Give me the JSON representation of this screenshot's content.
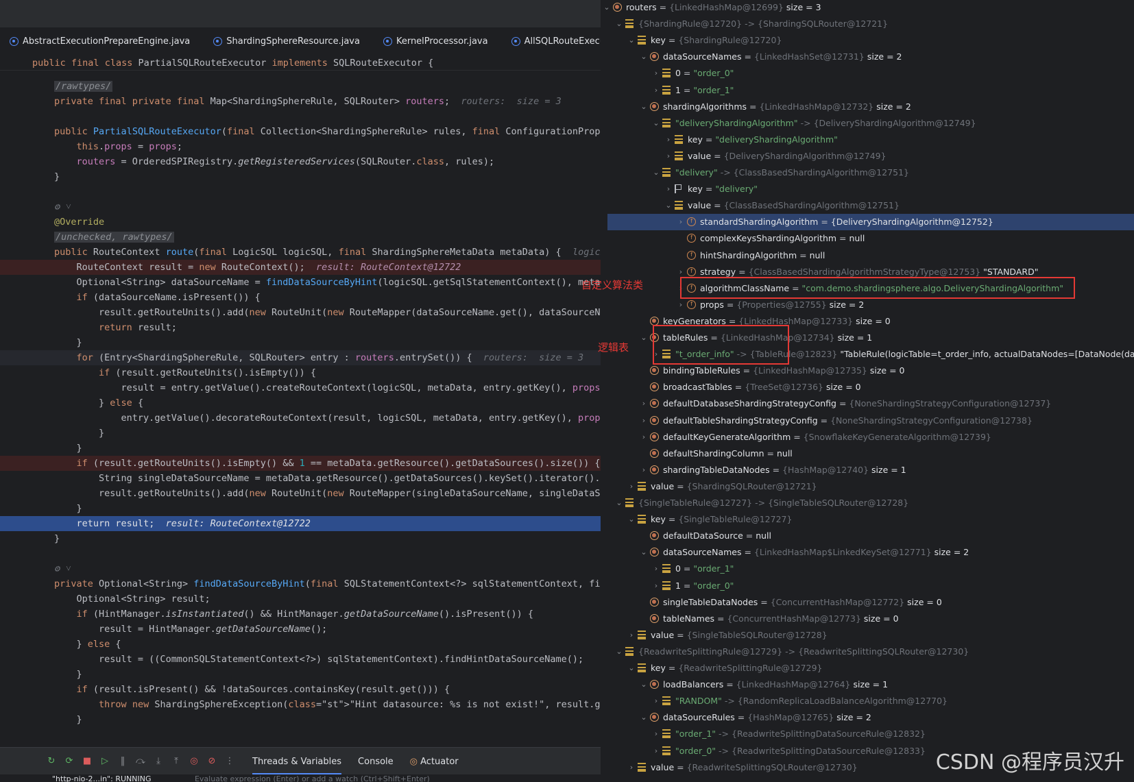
{
  "editor": {
    "tabs": [
      {
        "label": "AbstractExecutionPrepareEngine.java"
      },
      {
        "label": "ShardingSphereResource.java"
      },
      {
        "label": "KernelProcessor.java"
      },
      {
        "label": "AllSQLRouteExecutor.java"
      }
    ],
    "class_header": "public final class PartialSQLRouteExecutor implements SQLRouteExecutor {",
    "lines": {
      "l1_sup": "/rawtypes/",
      "l2": "private final Map<ShardingSphereRule, SQLRouter> routers;",
      "l2_hint": "routers:  size = 3",
      "l4": "public PartialSQLRouteExecutor(final Collection<ShardingSphereRule> rules, final ConfigurationProper",
      "l5": "this.props = props;",
      "l6": "routers = OrderedSPIRegistry.getRegisteredServices(SQLRouter.class, rules);",
      "l7": "}",
      "l9_icon": "⚙ ˅",
      "l10": "@Override",
      "l11_sup": "/unchecked, rawtypes/",
      "l12": "public RouteContext route(final LogicSQL logicSQL, final ShardingSphereMetaData metaData) {",
      "l12_hint": "logicS",
      "l13": "RouteContext result = new RouteContext();",
      "l13_hint": "result: RouteContext@12722",
      "l14": "Optional<String> dataSourceName = findDataSourceByHint(logicSQL.getSqlStatementContext(), metaDa",
      "l15": "if (dataSourceName.isPresent()) {",
      "l16": "result.getRouteUnits().add(new RouteUnit(new RouteMapper(dataSourceName.get(), dataSourceNam",
      "l17": "return result;",
      "l18": "}",
      "l19": "for (Entry<ShardingSphereRule, SQLRouter> entry : routers.entrySet()) {",
      "l19_hint": "routers:  size = 3",
      "l20": "if (result.getRouteUnits().isEmpty()) {",
      "l21": "result = entry.getValue().createRouteContext(logicSQL, metaData, entry.getKey(), props);",
      "l22": "} else {",
      "l23": "entry.getValue().decorateRouteContext(result, logicSQL, metaData, entry.getKey(), props",
      "l24": "}",
      "l25": "}",
      "l26": "if (result.getRouteUnits().isEmpty() && 1 == metaData.getResource().getDataSources().size()) {",
      "l27": "String singleDataSourceName = metaData.getResource().getDataSources().keySet().iterator().ne",
      "l28": "result.getRouteUnits().add(new RouteUnit(new RouteMapper(singleDataSourceName, singleDataSou",
      "l29": "}",
      "l30": "return result;",
      "l30_hint": "result: RouteContext@12722",
      "l31": "}",
      "l33_icon": "⚙ ˅",
      "l34": "private Optional<String> findDataSourceByHint(final SQLStatementContext<?> sqlStatementContext, fina",
      "l35": "Optional<String> result;",
      "l36": "if (HintManager.isInstantiated() && HintManager.getDataSourceName().isPresent()) {",
      "l37": "result = HintManager.getDataSourceName();",
      "l38": "} else {",
      "l39": "result = ((CommonSQLStatementContext<?>) sqlStatementContext).findHintDataSourceName();",
      "l40": "}",
      "l41": "if (result.isPresent() && !dataSources.containsKey(result.get())) {",
      "l42": "throw new ShardingSphereException(\"Hint datasource: %s is not exist!\", result.get());",
      "l43": "}"
    },
    "bottom_tabs": {
      "threads_vars": "Threads & Variables",
      "console": "Console",
      "actuator": "Actuator"
    },
    "thread_row": "\"http-nio-2...in\": RUNNING",
    "eval_placeholder": "Evaluate expression (Enter) or add a watch (Ctrl+Shift+Enter)"
  },
  "tree": [
    {
      "name": "routers",
      "ref": "{LinkedHashMap@12699}",
      "extra": "size = 3"
    },
    {
      "name": "{ShardingRule@12720}",
      "arrow": "->",
      "ref": "{ShardingSQLRouter@12721}"
    },
    {
      "name": "key",
      "ref": "{ShardingRule@12720}"
    },
    {
      "name": "dataSourceNames",
      "ref": "{LinkedHashSet@12731}",
      "extra": "size = 2"
    },
    {
      "name": "0",
      "str": "\"order_0\""
    },
    {
      "name": "1",
      "str": "\"order_1\""
    },
    {
      "name": "shardingAlgorithms",
      "ref": "{LinkedHashMap@12732}",
      "extra": "size = 2"
    },
    {
      "name": "\"deliveryShardingAlgorithm\"",
      "arrow": "->",
      "ref": "{DeliveryShardingAlgorithm@12749}"
    },
    {
      "name": "key",
      "str": "\"deliveryShardingAlgorithm\""
    },
    {
      "name": "value",
      "ref": "{DeliveryShardingAlgorithm@12749}"
    },
    {
      "name": "\"delivery\"",
      "arrow": "->",
      "ref": "{ClassBasedShardingAlgorithm@12751}"
    },
    {
      "name": "key",
      "str": "\"delivery\""
    },
    {
      "name": "value",
      "ref": "{ClassBasedShardingAlgorithm@12751}"
    },
    {
      "name": "standardShardingAlgorithm",
      "valtext": "{DeliveryShardingAlgorithm@12752}"
    },
    {
      "name": "complexKeysShardingAlgorithm",
      "valtext": "null"
    },
    {
      "name": "hintShardingAlgorithm",
      "valtext": "null"
    },
    {
      "name": "strategy",
      "ref": "{ClassBasedShardingAlgorithmStrategyType@12753}",
      "extra": "\"STANDARD\""
    },
    {
      "name": "algorithmClassName",
      "str": "\"com.demo.shardingsphere.algo.DeliveryShardingAlgorithm\""
    },
    {
      "name": "props",
      "ref": "{Properties@12755}",
      "extra": "size = 2"
    },
    {
      "name": "keyGenerators",
      "ref": "{LinkedHashMap@12733}",
      "extra": "size = 0"
    },
    {
      "name": "tableRules",
      "ref": "{LinkedHashMap@12734}",
      "extra": "size = 1"
    },
    {
      "name": "\"t_order_info\"",
      "arrow": "->",
      "ref": "{TableRule@12823}",
      "extra": "\"TableRule(logicTable=t_order_info, actualDataNodes=[DataNode(dataSou"
    },
    {
      "name": "bindingTableRules",
      "ref": "{LinkedHashMap@12735}",
      "extra": "size = 0"
    },
    {
      "name": "broadcastTables",
      "ref": "{TreeSet@12736}",
      "extra": "size = 0"
    },
    {
      "name": "defaultDatabaseShardingStrategyConfig",
      "ref": "{NoneShardingStrategyConfiguration@12737}"
    },
    {
      "name": "defaultTableShardingStrategyConfig",
      "ref": "{NoneShardingStrategyConfiguration@12738}"
    },
    {
      "name": "defaultKeyGenerateAlgorithm",
      "ref": "{SnowflakeKeyGenerateAlgorithm@12739}"
    },
    {
      "name": "defaultShardingColumn",
      "valtext": "null"
    },
    {
      "name": "shardingTableDataNodes",
      "ref": "{HashMap@12740}",
      "extra": "size = 1"
    },
    {
      "name": "value",
      "ref": "{ShardingSQLRouter@12721}"
    },
    {
      "name": "{SingleTableRule@12727}",
      "arrow": "->",
      "ref": "{SingleTableSQLRouter@12728}"
    },
    {
      "name": "key",
      "ref": "{SingleTableRule@12727}"
    },
    {
      "name": "defaultDataSource",
      "valtext": "null"
    },
    {
      "name": "dataSourceNames",
      "ref": "{LinkedHashMap$LinkedKeySet@12771}",
      "extra": "size = 2"
    },
    {
      "name": "0",
      "str": "\"order_1\""
    },
    {
      "name": "1",
      "str": "\"order_0\""
    },
    {
      "name": "singleTableDataNodes",
      "ref": "{ConcurrentHashMap@12772}",
      "extra": "size = 0"
    },
    {
      "name": "tableNames",
      "ref": "{ConcurrentHashMap@12773}",
      "extra": "size = 0"
    },
    {
      "name": "value",
      "ref": "{SingleTableSQLRouter@12728}"
    },
    {
      "name": "{ReadwriteSplittingRule@12729}",
      "arrow": "->",
      "ref": "{ReadwriteSplittingSQLRouter@12730}"
    },
    {
      "name": "key",
      "ref": "{ReadwriteSplittingRule@12729}"
    },
    {
      "name": "loadBalancers",
      "ref": "{LinkedHashMap@12764}",
      "extra": "size = 1"
    },
    {
      "name": "\"RANDOM\"",
      "arrow": "->",
      "ref": "{RandomReplicaLoadBalanceAlgorithm@12770}"
    },
    {
      "name": "dataSourceRules",
      "ref": "{HashMap@12765}",
      "extra": "size = 2"
    },
    {
      "name": "\"order_1\"",
      "arrow": "->",
      "ref": "{ReadwriteSplittingDataSourceRule@12832}"
    },
    {
      "name": "\"order_0\"",
      "arrow": "->",
      "ref": "{ReadwriteSplittingDataSourceRule@12833}"
    },
    {
      "name": "value",
      "ref": "{ReadwriteSplittingSQLRouter@12730}"
    }
  ],
  "annotations": {
    "custom_algorithm_class": "自定义算法类",
    "logical_table": "逻辑表"
  },
  "watermark": "CSDN @程序员汉升"
}
